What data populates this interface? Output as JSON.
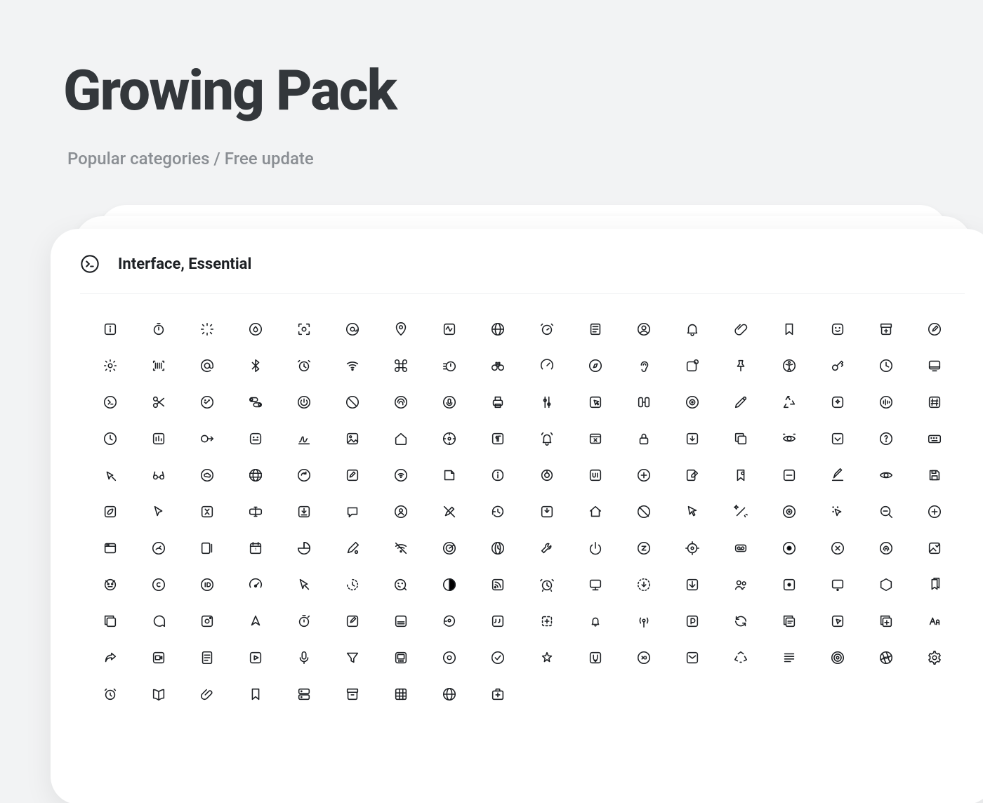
{
  "title": "Growing Pack",
  "subtitle": "Popular categories / Free update",
  "card": {
    "title": "Interface, Essential",
    "header_icon": "terminal-circle-icon"
  },
  "icons": [
    [
      "info-square-icon",
      "stopwatch-icon",
      "loading-icon",
      "water-drop-circle-icon",
      "scan-focus-icon",
      "at-circle-icon",
      "location-pin-icon",
      "activity-square-icon",
      "globe-icon",
      "alarm-clock-icon",
      "book-lines-icon",
      "user-circle-icon",
      "bell-icon",
      "paperclip-icon",
      "bookmark-icon",
      "smiley-square-icon",
      "archive-add-icon",
      "edit-circle-icon",
      "settings-gear-icon"
    ],
    [
      "barcode-scan-icon",
      "at-sign-icon",
      "bluetooth-icon",
      "alarm-bell-icon",
      "wifi-icon",
      "command-icon",
      "timer-fast-icon",
      "binoculars-icon",
      "speed-meter-icon",
      "compass-circle-icon",
      "ear-icon",
      "external-window-icon",
      "pushpin-icon",
      "accessibility-icon",
      "key-icon",
      "clock-light-icon",
      "desktop-icon",
      "terminal-run-icon",
      "scissors-icon"
    ],
    [
      "check-smile-icon",
      "toggles-icon",
      "power-circle-icon",
      "no-entry-icon",
      "fingerprint-circle-icon",
      "mic-circle-icon",
      "printer-icon",
      "slider-vertical-icon",
      "cursor-square-icon",
      "flip-panels-icon",
      "disc-target-icon",
      "pen-tool-icon",
      "recycle-icon",
      "sparkle-add-icon",
      "audio-wave-icon",
      "hashtag-square-icon",
      "clock-icon",
      "equalizer-box-icon",
      "send-right-icon"
    ],
    [
      "emoji-square-icon",
      "signature-icon",
      "image-icon",
      "home-outline-icon",
      "dashboard-gauge-icon",
      "paragraph-square-icon",
      "bell-ringing-icon",
      "window-close-icon",
      "lock-icon",
      "download-box-icon",
      "duplicate-icon",
      "eye-scan-icon",
      "checkbox-down-icon",
      "help-circle-icon",
      "keyboard-icon",
      "cursor-click-icon",
      "glasses-icon",
      "cloud-circle-icon",
      "world-web-icon"
    ],
    [
      "refresh-circle-icon",
      "edit-note-icon",
      "wifi-circle-icon",
      "sticker-icon",
      "info-rounded-icon",
      "chart-donut-icon",
      "ui-badge-icon",
      "add-sparkle-icon",
      "note-edit-icon",
      "bookmark-search-icon",
      "minus-square-icon",
      "edit-underline-icon",
      "eye-icon",
      "save-floppy-icon",
      "leaf-square-icon",
      "cursor-bold-icon",
      "collapse-square-icon",
      "rename-field-icon",
      "download-square-icon"
    ],
    [
      "chat-bubble-icon",
      "user-badge-icon",
      "no-edit-icon",
      "history-icon",
      "download-down-icon",
      "home-icon",
      "prohibited-icon",
      "cursor-arrow-icon",
      "magic-wand-icon",
      "target-dot-icon",
      "cursor-pointer-dots-icon",
      "zoom-out-icon",
      "add-circle-icon",
      "browser-window-icon",
      "rocket-gauge-icon",
      "note-pen-icon",
      "calendar-date-icon",
      "pie-chart-icon",
      "pencil-cursor-icon"
    ],
    [
      "no-wifi-icon",
      "radar-icon",
      "world-time-icon",
      "wrench-icon",
      "power-icon",
      "snooze-circle-icon",
      "find-target-icon",
      "voicemail-box-icon",
      "record-circle-icon",
      "x-circle-icon",
      "touch-id-icon",
      "photo-check-icon",
      "bug-face-icon",
      "copyright-icon",
      "id-circle-icon",
      "speedometer-icon",
      "cursor-bold-alt-icon",
      "partial-clock-icon"
    ],
    [
      "face-edit-icon",
      "contrast-circle-icon",
      "rss-square-icon",
      "alarm-ringing-icon",
      "display-stand-icon",
      "download-dashed-icon",
      "arrow-down-box-icon",
      "user-group-icon",
      "dot-square-icon",
      "screen-indicator-icon",
      "hexagon-icon",
      "bookmarks-icon",
      "stack-copy-icon",
      "chat-round-icon",
      "record-video-icon",
      "cursor-up-icon",
      "stopwatch-bold-icon",
      "compose-square-icon",
      "list-bottom-icon"
    ],
    [
      "reload-user-icon",
      "quote-square-icon",
      "select-dashed-icon",
      "bell-small-icon",
      "broadcast-icon",
      "parking-square-icon",
      "sync-circle-icon",
      "copy-text-icon",
      "cursor-box-icon",
      "duplicate-add-icon",
      "text-aa-icon",
      "share-forward-icon",
      "video-square-icon",
      "document-lines-icon",
      "play-square-icon",
      "microphone-icon",
      "filter-icon",
      "gallery-square-icon",
      "record-dot-icon"
    ],
    [
      "check-circle-icon",
      "star-sparkle-icon",
      "download-u-icon",
      "sound-off-icon",
      "mail-square-icon",
      "recycle-triangle-icon",
      "text-block-icon",
      "target-rings-icon",
      "aperture-icon",
      "settings-cog-icon",
      "alarm-basic-icon",
      "book-open-icon",
      "attachment-icon",
      "bookmark-outline-icon",
      "server-lines-icon",
      "archive-box-icon",
      "grid-table-icon",
      "globe-grid-icon",
      "first-aid-icon"
    ]
  ]
}
